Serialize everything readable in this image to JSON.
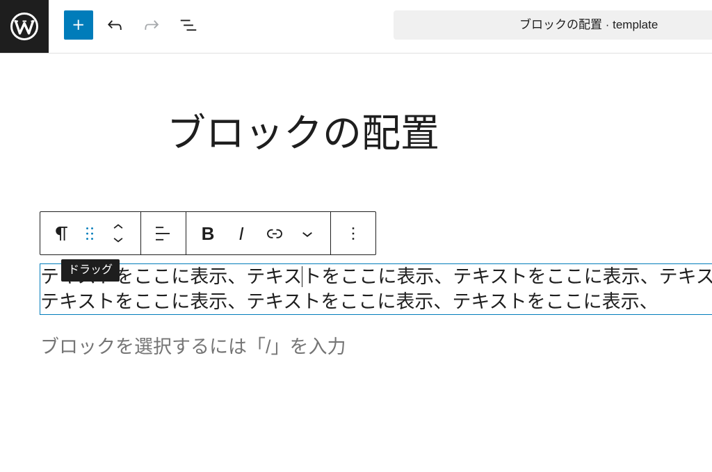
{
  "colors": {
    "accent": "#007cba",
    "text": "#1e1e1e",
    "placeholder": "#757575",
    "logo_background": "#1e1e1e",
    "document_bar_background": "#f0f0f0",
    "disabled_icon": "#a7aaad",
    "tooltip_background": "#1e1e1e"
  },
  "header": {
    "logo": {
      "icon": "wordpress-logo-icon"
    },
    "inserter_button": {
      "icon": "plus-icon"
    },
    "undo_button": {
      "icon": "undo-icon"
    },
    "redo_button": {
      "icon": "redo-icon",
      "disabled": true
    },
    "list_view_button": {
      "icon": "list-view-icon"
    },
    "document_bar": {
      "title": "ブロックの配置 · template"
    }
  },
  "editor": {
    "post_title": "ブロックの配置",
    "block_toolbar": {
      "block_type": {
        "icon": "paragraph-icon"
      },
      "drag_handle": {
        "icon": "drag-handle-icon"
      },
      "move_up": {
        "icon": "chevron-up-icon"
      },
      "move_down": {
        "icon": "chevron-down-icon"
      },
      "align": {
        "icon": "align-left-icon"
      },
      "bold": {
        "label": "B"
      },
      "italic": {
        "label": "I"
      },
      "link": {
        "icon": "link-icon"
      },
      "more_formats": {
        "icon": "chevron-down-icon"
      },
      "options": {
        "icon": "more-vertical-icon"
      }
    },
    "tooltip": {
      "text": "ドラッグ"
    },
    "paragraph": {
      "selected": true,
      "line_1_before_caret": "テキストをここに表示、テキス",
      "line_1_after_caret": "トをここに表示、テキストをここに表示、テキス",
      "line_2": "テキストをここに表示、テキストをここに表示、テキストをここに表示、"
    },
    "appender_placeholder": "ブロックを選択するには「/」を入力"
  }
}
